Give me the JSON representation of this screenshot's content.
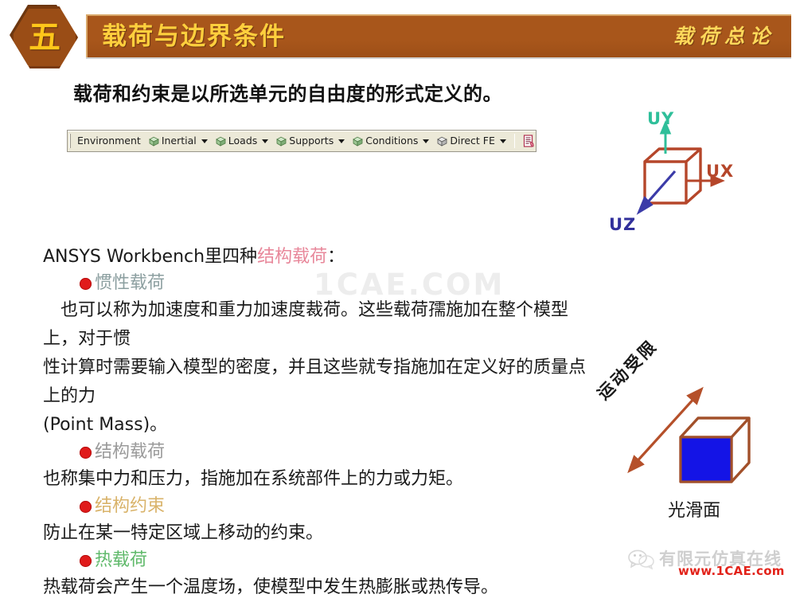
{
  "header": {
    "badge_number": "五",
    "title": "载荷与边界条件",
    "subtitle": "载荷总论",
    "bar_color": "#a8561b",
    "title_color": "#ffcf3d"
  },
  "lead": "载荷和约束是以所选单元的自由度的形式定义的。",
  "toolbar": {
    "environment_label": "Environment",
    "items": [
      {
        "label": "Inertial",
        "icon": "cube-icon",
        "caret": "chevron-down-icon"
      },
      {
        "label": "Loads",
        "icon": "cube-icon",
        "caret": "chevron-down-icon"
      },
      {
        "label": "Supports",
        "icon": "cube-icon",
        "caret": "chevron-down-icon"
      },
      {
        "label": "Conditions",
        "icon": "cube-icon",
        "caret": "chevron-down-icon"
      },
      {
        "label": "Direct FE",
        "icon": "cube-icon",
        "caret": "chevron-down-icon"
      }
    ],
    "end_icon": "document-report-icon"
  },
  "axis_figure": {
    "name": "coordinate-axes-cube",
    "uy_label": "UY",
    "ux_label": "UX",
    "uz_label": "UZ",
    "uy_color": "#2fbf9a",
    "ux_color": "#b5462a",
    "uz_color": "#31309b",
    "cube_color": "#b5462a"
  },
  "body": {
    "intro_prefix": "ANSYS Workbench里四种",
    "intro_highlight": "结构载荷",
    "intro_suffix": "：",
    "sections": [
      {
        "bullet": "惯性载荷",
        "bullet_color": "#8c9fa0",
        "paragraphs": [
          "　也可以称为加速度和重力加速度裁荷。这些载荷孺施加在整个模型上，对于惯",
          "性计算时需要输入模型的密度，并且这些就专指施加在定义好的质量点上的力",
          "(Point Mass)。"
        ]
      },
      {
        "bullet": "结构载荷",
        "bullet_color": "#9a9a9a",
        "paragraphs": [
          "也称集中力和压力，指施加在系统部件上的力或力矩。"
        ]
      },
      {
        "bullet": "结构约束",
        "bullet_color": "#d9b36a",
        "paragraphs": [
          "防止在某一特定区域上移动的约束。"
        ]
      },
      {
        "bullet": "热载荷",
        "bullet_color": "#5fb96a",
        "paragraphs": [
          "热载荷会产生一个温度场，使模型中发生热膨胀或热传导。"
        ]
      }
    ]
  },
  "cube_figure": {
    "name": "smooth-surface-cube",
    "motion_label": "运动受限",
    "caption": "光滑面",
    "face_color": "#1414e6",
    "edge_color": "#a2502a",
    "arrow_color": "#b5502a"
  },
  "watermarks": {
    "center": "1CAE.COM",
    "footer_cn": "有限元仿真在线",
    "footer_url": "www.1CAE.com",
    "footer_icon": "wechat-icon"
  }
}
